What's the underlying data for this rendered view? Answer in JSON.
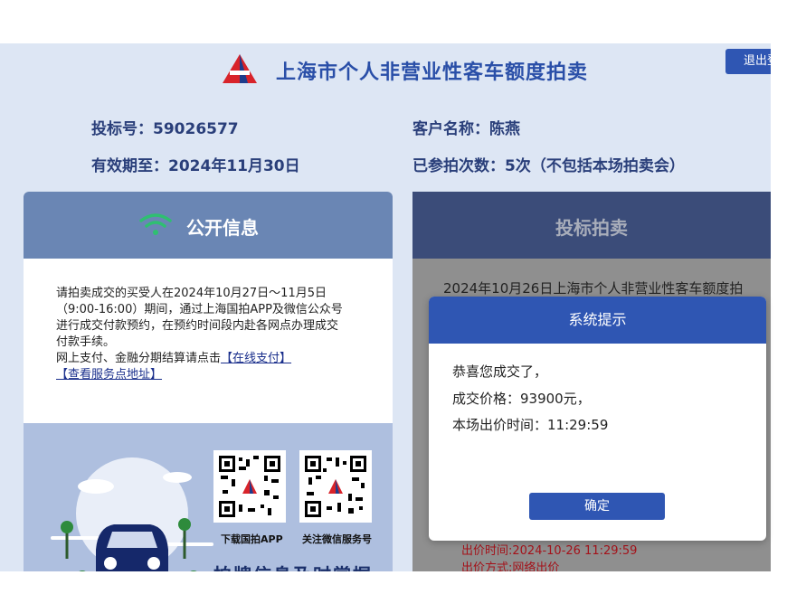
{
  "header": {
    "title": "上海市个人非营业性客车额度拍卖",
    "logout_label": "退出登"
  },
  "bidder": {
    "bid_number": "投标号：59026577",
    "valid_until": "有效期至：2024年11月30日",
    "customer_name": "客户名称：陈燕",
    "auction_count": "已参拍次数：5次（不包括本场拍卖会）"
  },
  "public_info": {
    "title": "公开信息",
    "notice_lines": [
      "请拍卖成交的买受人在2024年10月27日～11月5日",
      "（9:00-16:00）期间，通过上海国拍APP及微信公众号",
      "进行成交付款预约，在预约时间段内赴各网点办理成交",
      "付款手续。",
      "网上支付、金融分期结算请点击"
    ],
    "link_pay": "【在线支付】",
    "link_service": "【查看服务点地址】",
    "qr_app_label": "下载国拍APP",
    "qr_wechat_label": "关注微信服务号",
    "slogan": "拍牌信息及时掌握"
  },
  "bidding": {
    "title": "投标拍卖",
    "background_text": "2024年10月26日上海市个人非营业性客车额度拍",
    "bid_time_line": "出价时间:2024-10-26 11:29:59",
    "bid_method_line": "出价方式:网络出价"
  },
  "dialog": {
    "title": "系统提示",
    "line1": "恭喜您成交了，",
    "line2": "成交价格：93900元，",
    "line3": "本场出价时间：11:29:59",
    "confirm_label": "确定"
  },
  "colors": {
    "accent": "#2f56b3",
    "page_bg": "#dde6f4",
    "wifi_green": "#2fbf71",
    "alert_red": "#a4121a"
  }
}
